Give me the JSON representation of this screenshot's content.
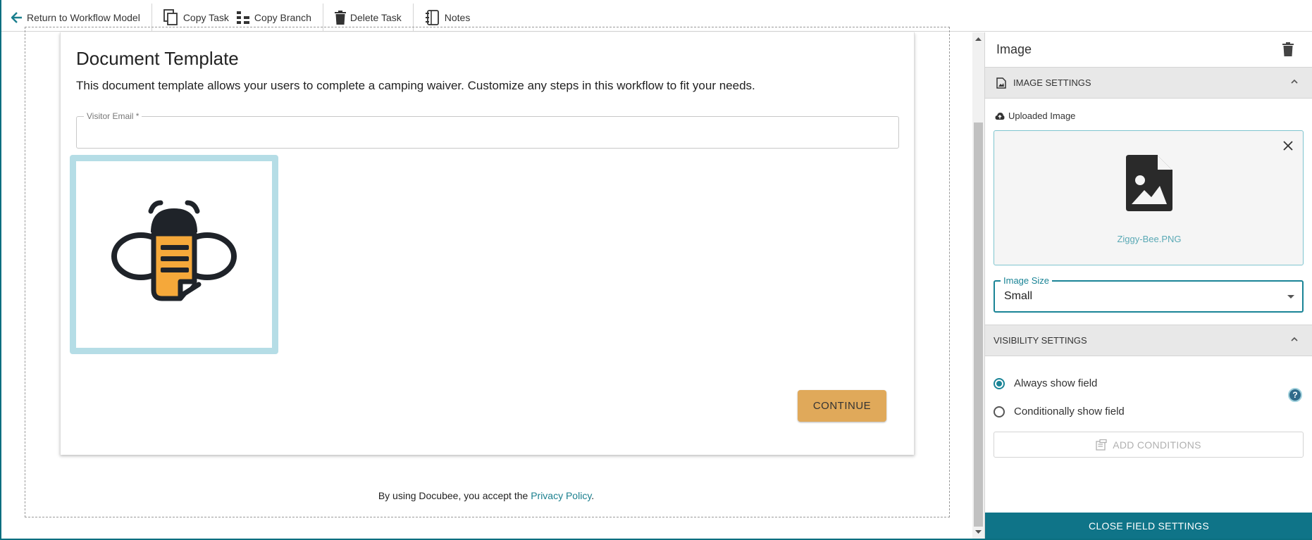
{
  "toolbar": {
    "return_label": "Return to Workflow Model",
    "copy_task_label": "Copy Task",
    "copy_branch_label": "Copy Branch",
    "delete_task_label": "Delete Task",
    "notes_label": "Notes"
  },
  "document": {
    "title": "Document Template",
    "description": "This document template allows your users to complete a camping waiver. Customize any steps in this workflow to fit your needs.",
    "email_label": "Visitor Email *",
    "continue_label": "CONTINUE",
    "footer_prefix": "By using Docubee, you accept the ",
    "footer_link": "Privacy Policy",
    "footer_suffix": "."
  },
  "panel": {
    "title": "Image",
    "image_settings_header": "IMAGE SETTINGS",
    "uploaded_image_label": "Uploaded Image",
    "file_name": "Ziggy-Bee.PNG",
    "image_size_label": "Image Size",
    "image_size_value": "Small",
    "visibility_header": "VISIBILITY SETTINGS",
    "always_show_label": "Always show field",
    "conditionally_show_label": "Conditionally show field",
    "always_show_selected": true,
    "add_conditions_label": "ADD CONDITIONS",
    "close_label": "CLOSE FIELD SETTINGS"
  },
  "colors": {
    "accent": "#0f7488",
    "continue_button": "#e0a95a",
    "image_frame": "#b5dde6",
    "bee_orange": "#f5a83a",
    "bee_dark": "#1f2329"
  }
}
